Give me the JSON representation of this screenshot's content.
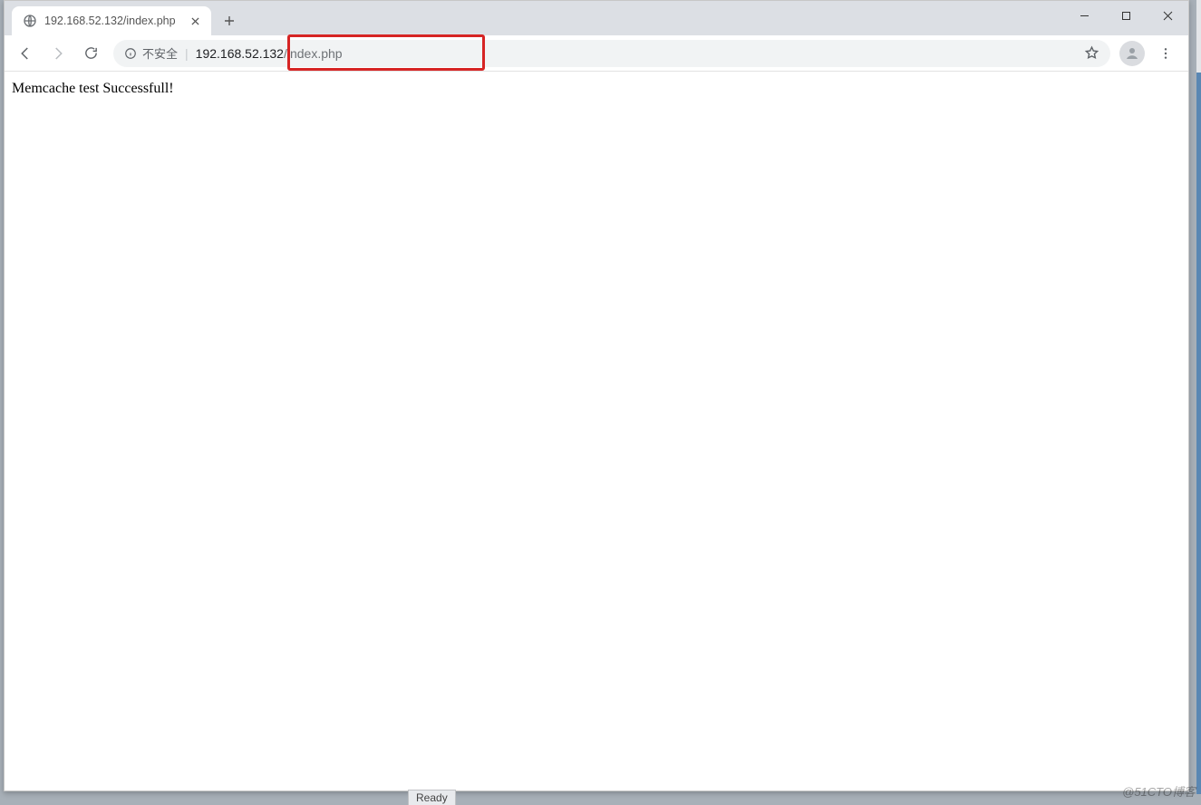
{
  "tab": {
    "title": "192.168.52.132/index.php"
  },
  "toolbar": {
    "insecure_label": "不安全",
    "url_host": "192.168.52.132",
    "url_path": "/index.php"
  },
  "page": {
    "body_text": "Memcache test Successfull!"
  },
  "background": {
    "status_text": "Ready"
  },
  "watermark": "@51CTO博客"
}
